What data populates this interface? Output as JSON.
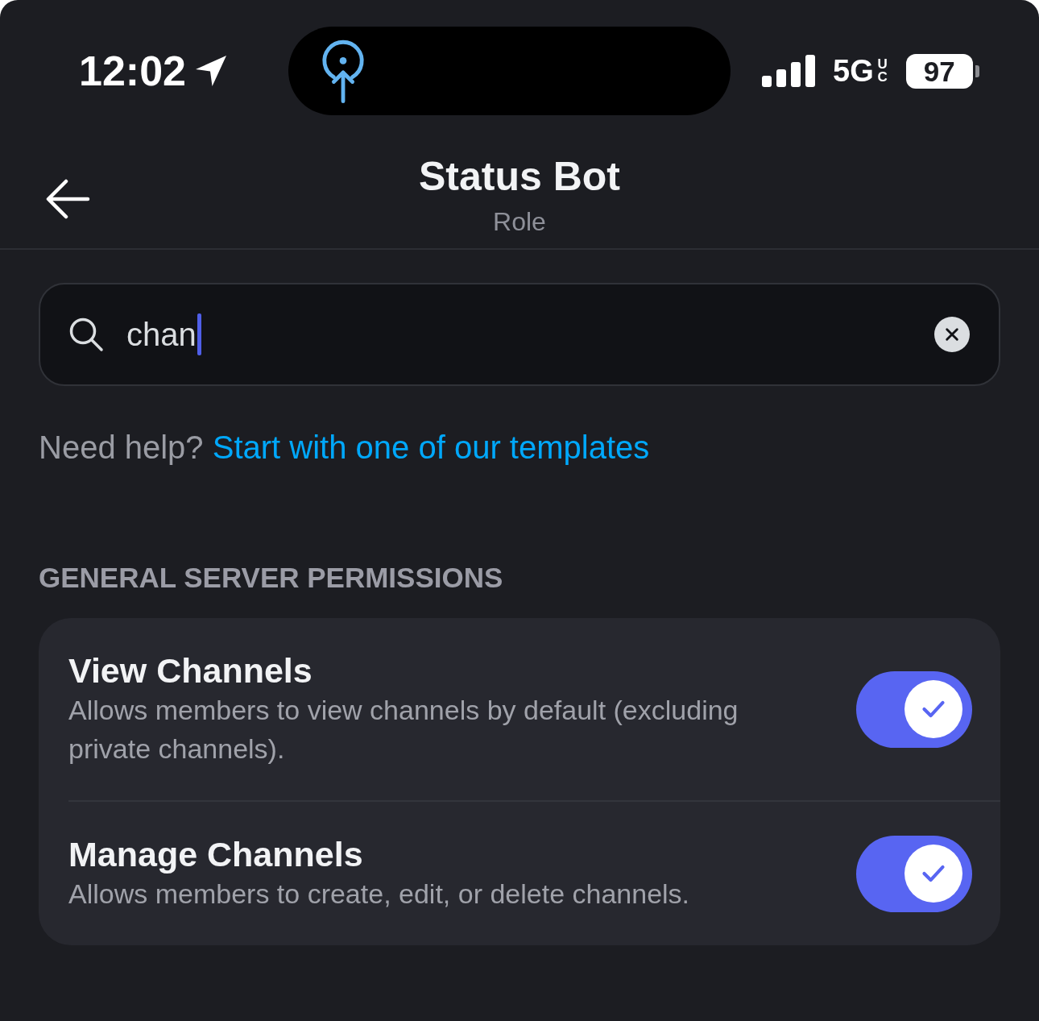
{
  "status_bar": {
    "time": "12:02",
    "network": "5G",
    "network_badge": "UC",
    "battery": "97"
  },
  "header": {
    "title": "Status Bot",
    "subtitle": "Role"
  },
  "search": {
    "value": "chan",
    "focused": true
  },
  "help": {
    "text": "Need help?",
    "link": "Start with one of our templates"
  },
  "sections": [
    {
      "title": "GENERAL SERVER PERMISSIONS",
      "permissions": [
        {
          "name": "View Channels",
          "description": "Allows members to view channels by default (excluding private channels).",
          "on": true
        },
        {
          "name": "Manage Channels",
          "description": "Allows members to create, edit, or delete channels.",
          "on": true
        }
      ]
    }
  ]
}
